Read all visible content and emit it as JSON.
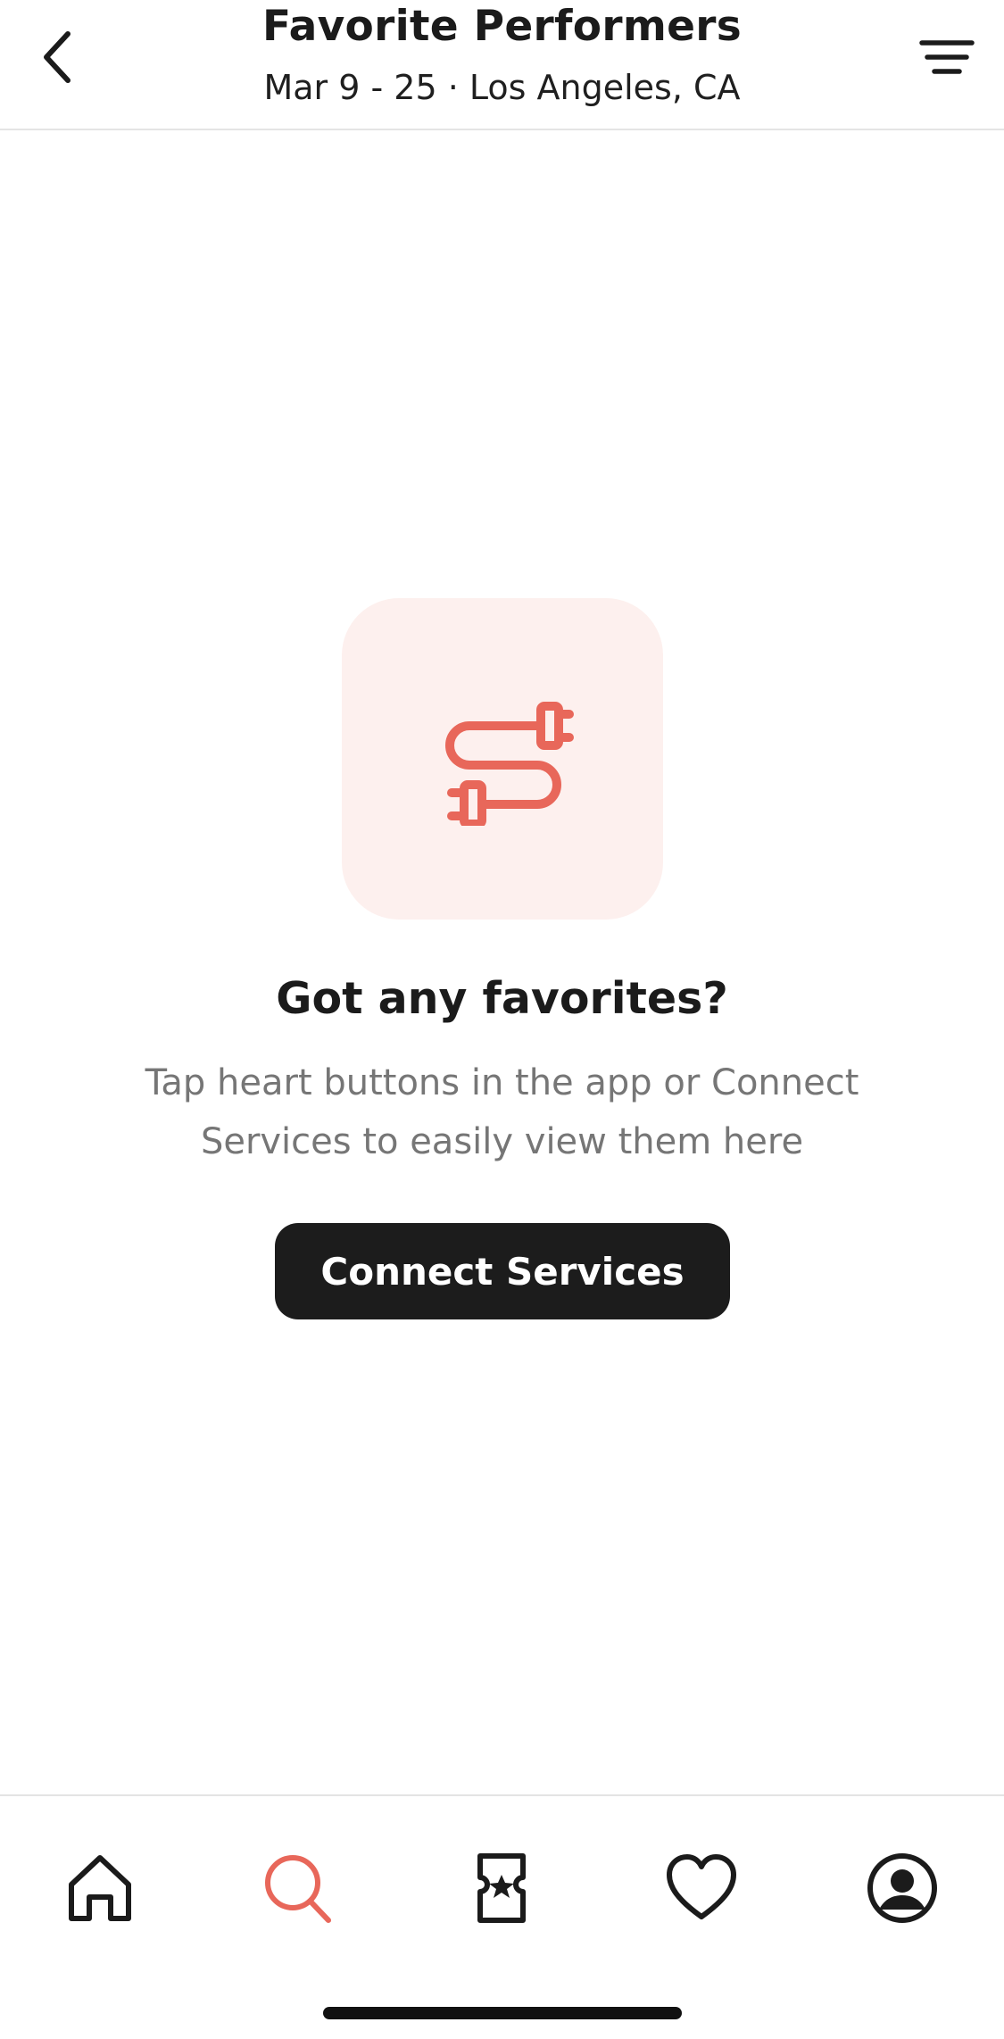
{
  "header": {
    "title": "Favorite Performers",
    "subtitle": "Mar 9 - 25 · Los Angeles, CA",
    "back_icon": "chevron-left-icon",
    "filter_icon": "filter-lines-icon"
  },
  "empty_state": {
    "icon": "plug-cable-icon",
    "title": "Got any favorites?",
    "description": "Tap heart buttons in the app or Connect Services to easily view them here",
    "button_label": "Connect Services"
  },
  "tabbar": {
    "items": [
      {
        "name": "Home",
        "icon": "home-icon",
        "active": false
      },
      {
        "name": "Search",
        "icon": "search-icon",
        "active": true
      },
      {
        "name": "Tickets",
        "icon": "ticket-icon",
        "active": false
      },
      {
        "name": "Favorites",
        "icon": "heart-icon",
        "active": false
      },
      {
        "name": "Account",
        "icon": "account-icon",
        "active": false
      }
    ]
  },
  "colors": {
    "accent": "#e8675a",
    "accent_bg": "#fdf0ee",
    "dark": "#1c1c1c",
    "muted_text": "#767676"
  }
}
